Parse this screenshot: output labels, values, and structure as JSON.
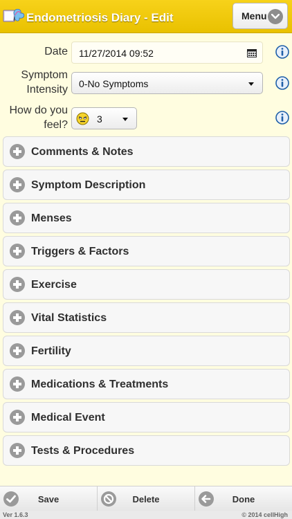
{
  "header": {
    "title": "Endometriosis Diary - Edit",
    "menu_label": "Menu"
  },
  "form": {
    "date": {
      "label": "Date",
      "value": "11/27/2014 09:52"
    },
    "intensity": {
      "label_line1": "Symptom",
      "label_line2": "Intensity",
      "value": "0-No Symptoms"
    },
    "feel": {
      "label_line1": "How do you",
      "label_line2": "feel?",
      "value": "3"
    }
  },
  "sections": [
    {
      "label": "Comments & Notes"
    },
    {
      "label": "Symptom Description"
    },
    {
      "label": "Menses"
    },
    {
      "label": "Triggers & Factors"
    },
    {
      "label": "Exercise"
    },
    {
      "label": "Vital Statistics"
    },
    {
      "label": "Fertility"
    },
    {
      "label": "Medications & Treatments"
    },
    {
      "label": "Medical Event"
    },
    {
      "label": "Tests & Procedures"
    }
  ],
  "footer": {
    "save": "Save",
    "delete": "Delete",
    "done": "Done"
  },
  "version": "Ver 1.6.3",
  "copyright": "© 2014 cellHigh",
  "colors": {
    "header": "#f0c80a",
    "background": "#fffde0",
    "info": "#1f5fa8"
  }
}
